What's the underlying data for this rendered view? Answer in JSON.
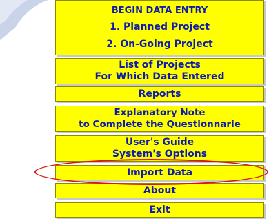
{
  "menu": {
    "begin_header": "BEGIN DATA ENTRY",
    "planned_project": "1. Planned Project",
    "ongoing_project": "2. On-Going Project",
    "list_projects_line1": "List of Projects",
    "list_projects_line2": "For Which Data Entered",
    "reports": "Reports",
    "explanatory_line1": "Explanatory Note",
    "explanatory_line2": "to Complete the Questionnarie",
    "users_guide_line1": "User's Guide",
    "users_guide_line2": "System's Options",
    "import_data": "Import Data",
    "about": "About",
    "exit": "Exit"
  },
  "colors": {
    "button_bg": "#ffff00",
    "button_text": "#0d1bb0",
    "highlight_ellipse": "#e01010"
  }
}
